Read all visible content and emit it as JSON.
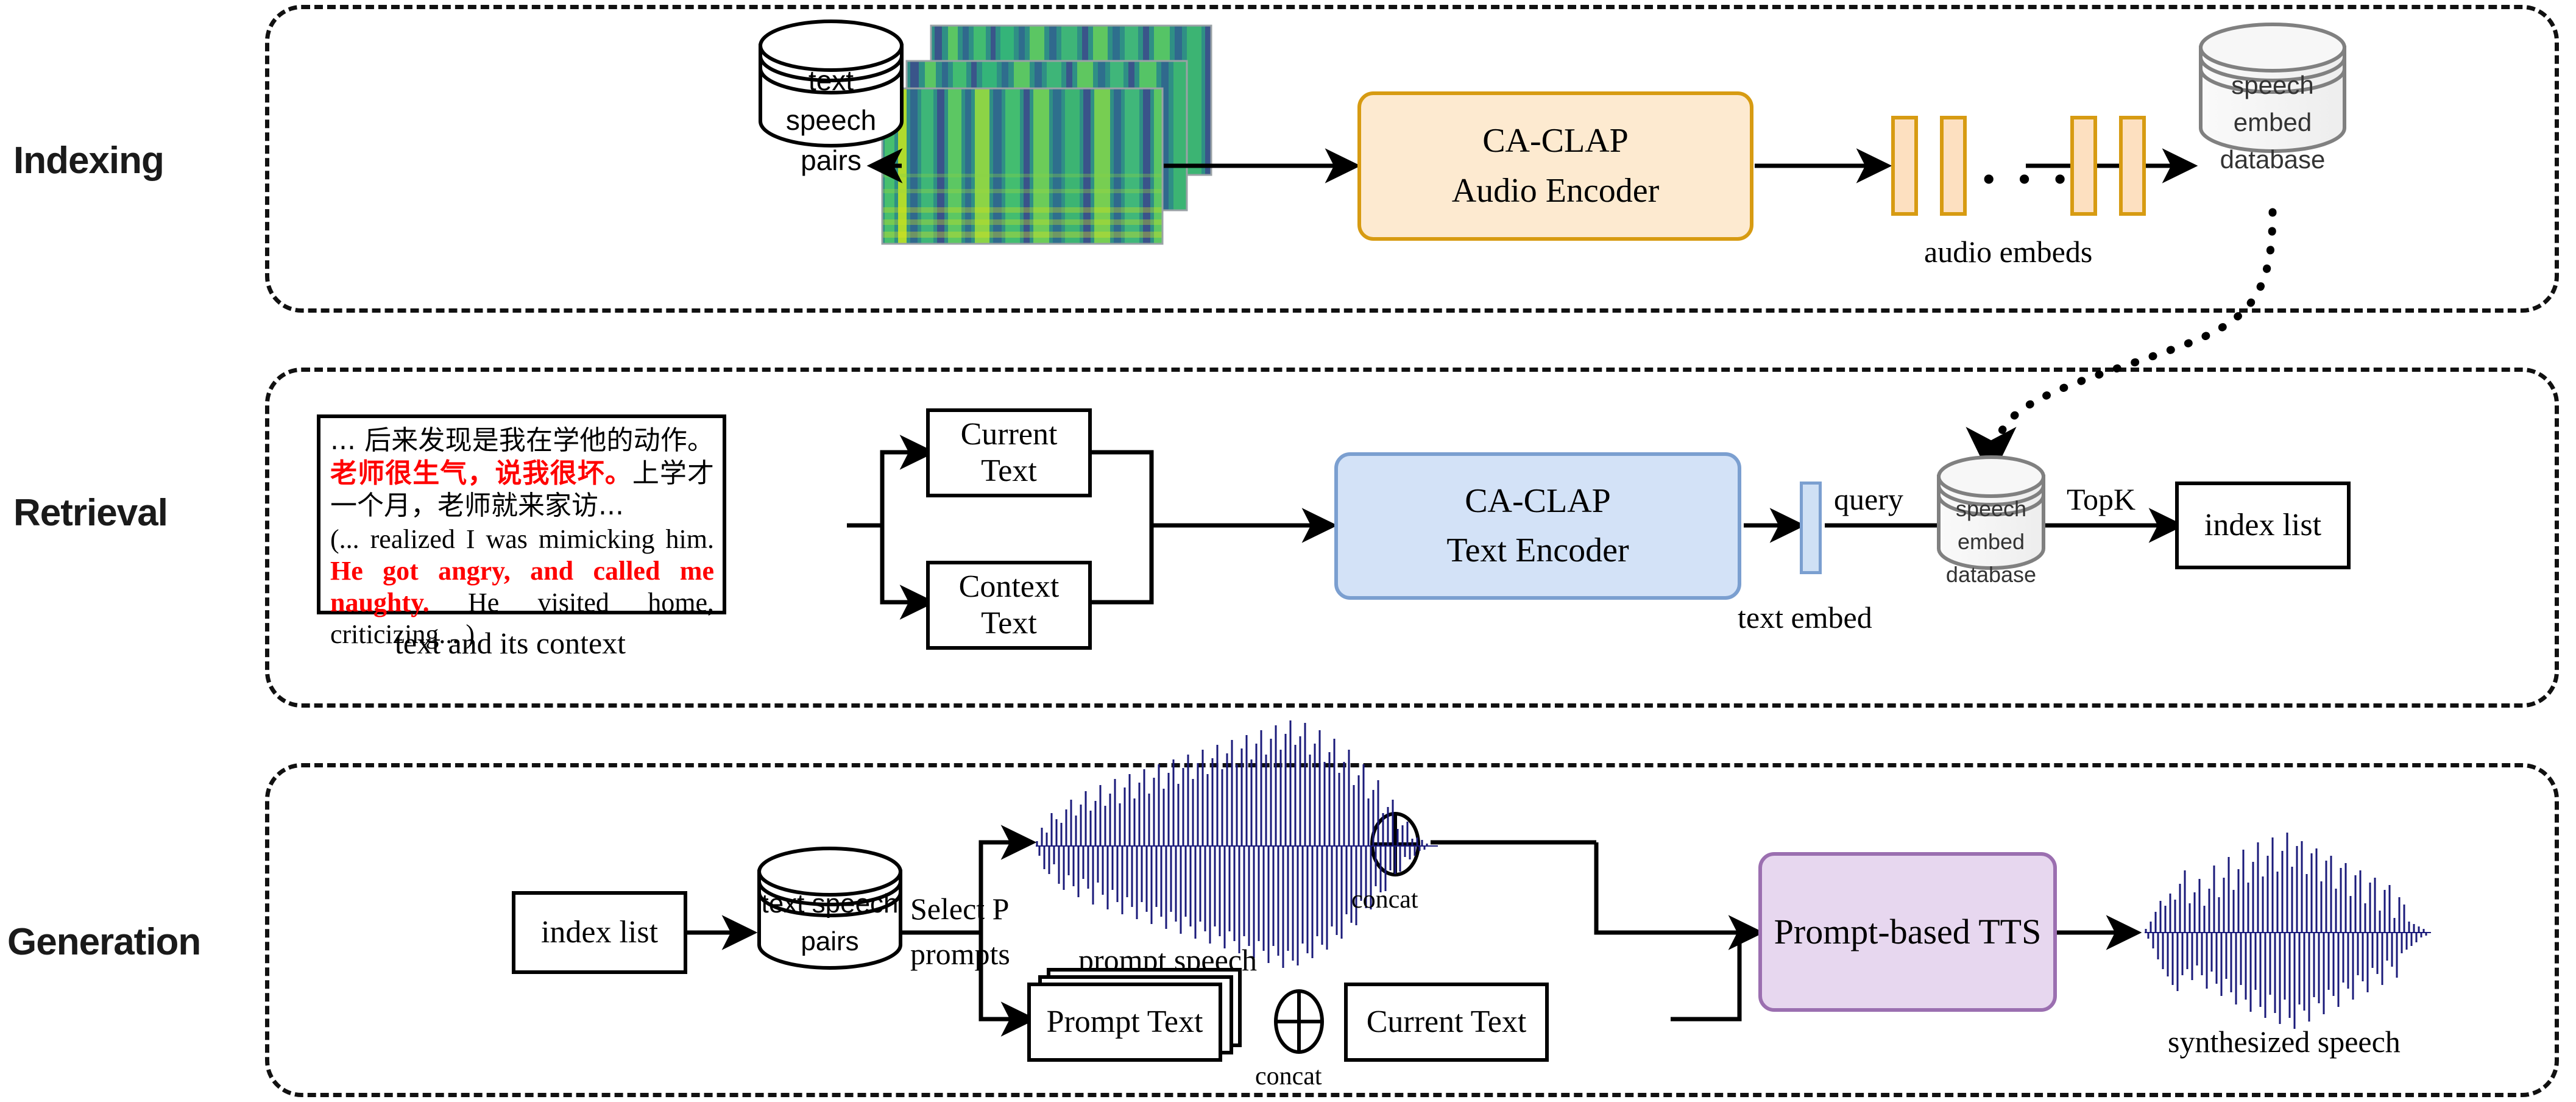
{
  "sections": [
    {
      "id": "indexing",
      "label": "Indexing"
    },
    {
      "id": "retrieval",
      "label": "Retrieval"
    },
    {
      "id": "generation",
      "label": "Generation"
    }
  ],
  "indexing": {
    "db_text_speech_pairs": "text speech\npairs",
    "spectrograms_icon": "spectrogram-stack",
    "audio_encoder": {
      "line1": "CA-CLAP",
      "line2": "Audio Encoder"
    },
    "audio_embeds_label": "audio embeds",
    "ellipsis": "• • •",
    "db_speech_embed": "speech embed\ndatabase"
  },
  "retrieval": {
    "sample_text": {
      "cn_prefix": "... 后来发现是我在学他的动作。",
      "cn_red": "老师很生气，说我很坏。",
      "cn_suffix": "上学才一个月，老师就来家访...",
      "en_prefix": "(... realized I was mimicking him. ",
      "en_red": "He got angry, and called me naughty.",
      "en_suffix": " He visited home, criticizing... )"
    },
    "caption": "text and its context",
    "current_text": "Current Text",
    "context_text": "Context Text",
    "text_encoder": {
      "line1": "CA-CLAP",
      "line2": "Text Encoder"
    },
    "text_embed_label": "text embed",
    "query_label": "query",
    "db_speech_embed": "speech embed\ndatabase",
    "topk_label": "TopK",
    "index_list": "index list"
  },
  "generation": {
    "index_list": "index list",
    "db_text_speech_pairs": "text speech\npairs",
    "select_label_line1": "Select P",
    "select_label_line2": "prompts",
    "prompt_speech_label": "prompt speech",
    "prompt_speech_icon": "waveform",
    "concat_top_label": "concat",
    "concat_bottom_label": "concat",
    "concat_icon": "circled-plus-icon",
    "prompt_text": "Prompt Text",
    "current_text": "Current Text",
    "tts_box": "Prompt-based TTS",
    "synthesized_speech_label": "synthesized speech",
    "synthesized_speech_icon": "waveform"
  },
  "colors": {
    "audio_encoder_fill": "#fdead0",
    "audio_encoder_stroke": "#d79b12",
    "text_encoder_fill": "#d3e2f7",
    "text_encoder_stroke": "#7b9fd0",
    "tts_fill": "#e7d7ef",
    "tts_stroke": "#9b6fb0",
    "waveform": "#1a1a7a",
    "highlight_text": "#ff0000",
    "database_fill": "#f2f2f2",
    "database_stroke": "#808080"
  }
}
